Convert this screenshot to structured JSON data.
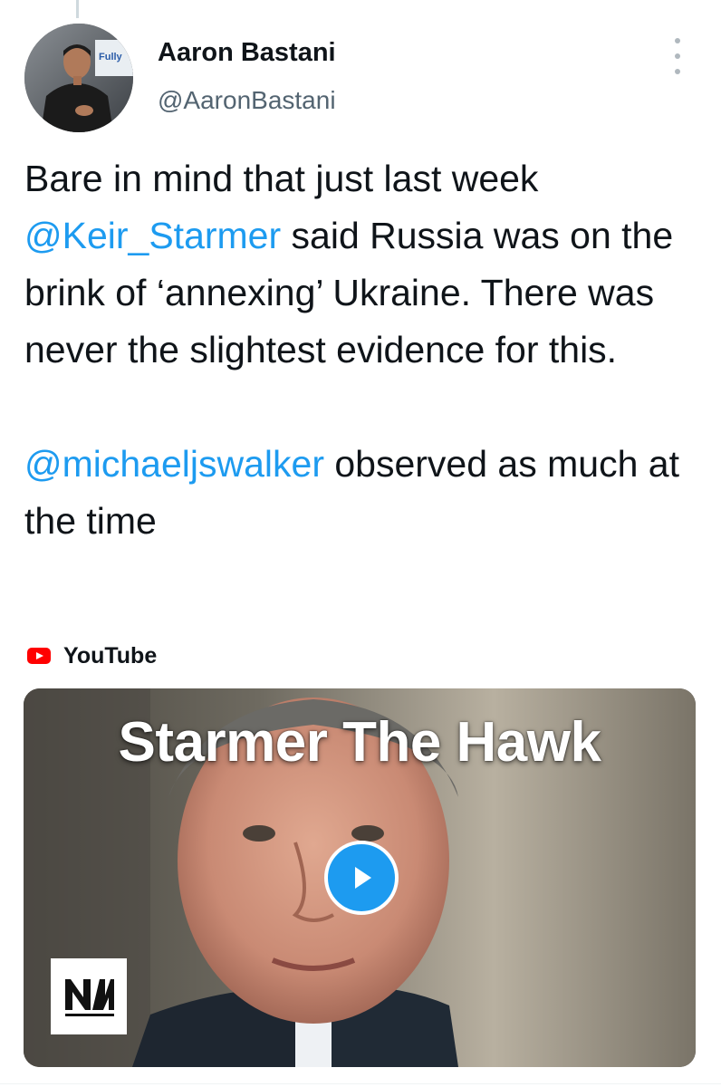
{
  "tweet": {
    "author": {
      "name": "Aaron Bastani",
      "handle": "@AaronBastani",
      "avatar_icon": "profile-photo"
    },
    "body": {
      "segments_p1": [
        {
          "text": "Bare in mind that just last week ",
          "type": "text"
        },
        {
          "text": "@Keir_Starmer",
          "type": "mention"
        },
        {
          "text": " said Russia was on the brink of ‘annexing’ Ukraine. There was never the slightest evidence for this.",
          "type": "text"
        }
      ],
      "p1_a": "Bare in mind that just last week",
      "mention1": "@Keir_Starmer",
      "p1_b": " said Russia was on the brink of ‘annexing’ Ukraine. There was never the slightest evidence for this.",
      "mention2": "@michaeljswalker",
      "p2_b": " observed as much at the time"
    },
    "more_icon": "more-vertical-icon",
    "link_card": {
      "source": "YouTube",
      "source_icon": "youtube-icon",
      "thumbnail_title": "Starmer The Hawk",
      "play_icon": "play-icon",
      "logo_text": "NM",
      "accent_color": "#1d9bf0",
      "youtube_red": "#ff0000"
    }
  }
}
